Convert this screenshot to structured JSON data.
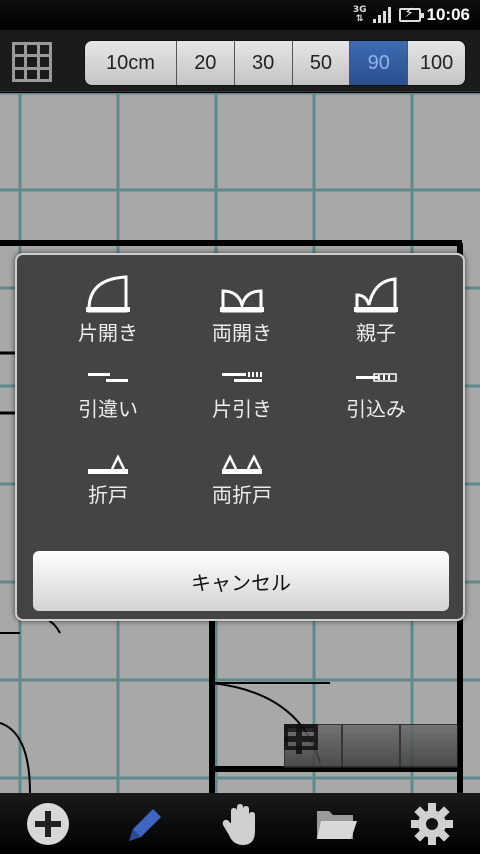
{
  "status_bar": {
    "network": "3G",
    "time": "10:06"
  },
  "scale": {
    "options": [
      "10cm",
      "20",
      "30",
      "50",
      "90",
      "100"
    ],
    "selected": "90"
  },
  "dialog": {
    "items": [
      {
        "label": "片開き",
        "icon": "single-swing-door-icon"
      },
      {
        "label": "両開き",
        "icon": "double-swing-door-icon"
      },
      {
        "label": "親子",
        "icon": "unequal-double-door-icon"
      },
      {
        "label": "引違い",
        "icon": "sliding-double-door-icon"
      },
      {
        "label": "片引き",
        "icon": "single-sliding-door-icon"
      },
      {
        "label": "引込み",
        "icon": "pocket-door-icon"
      },
      {
        "label": "折戸",
        "icon": "folding-door-icon"
      },
      {
        "label": "両折戸",
        "icon": "double-folding-door-icon"
      }
    ],
    "cancel_label": "キャンセル"
  },
  "bottom_bar": {
    "buttons": [
      "add-icon",
      "pen-icon",
      "hand-icon",
      "folder-icon",
      "gear-icon"
    ]
  },
  "colors": {
    "active_scale": "#2a4f8f",
    "canvas_bg": "#a8a8a8",
    "grid_line": "#5e8a8a",
    "dialog_bg": "#444444"
  }
}
